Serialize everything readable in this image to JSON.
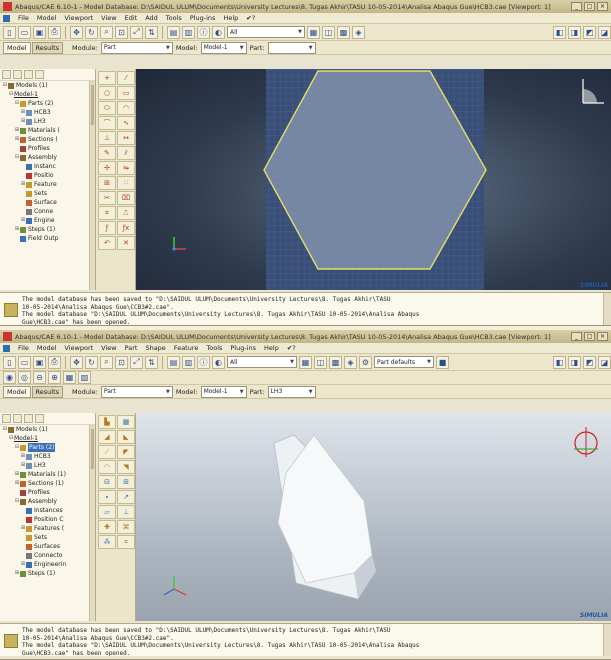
{
  "colors": {
    "viewport1_bg": "#2f3b4e",
    "part_fill": "#7f8fa6",
    "part_edge": "#e2dd6a",
    "mesh_grid": "#3d62b8",
    "selection": "#3d6fb7"
  },
  "panel1": {
    "window_title": "Abaqus/CAE 6.10-1 - Model Database: D:\\SAIDUL ULUM\\Documents\\University Lectures\\8. Tugas Akhir\\TASU 10-05-2014\\Analisa Abaqus Gue\\HCB3.cae [Viewport: 1]",
    "menus": [
      "File",
      "Model",
      "Viewport",
      "View",
      "Edit",
      "Add",
      "Tools",
      "Plug-ins",
      "Help",
      "✔?"
    ],
    "render_combo": "All",
    "tabs": [
      "Model",
      "Results"
    ],
    "module_label": "Module:",
    "module_value": "Part",
    "model_label": "Model:",
    "model_value": "Model-1",
    "part_label": "Part:",
    "part_value": "",
    "tree": [
      {
        "label": "Models (1)",
        "exp": "⊟",
        "indent": 0,
        "icon": "models-icon",
        "color": "#8a6b2f"
      },
      {
        "label": "Model-1",
        "exp": "⊟",
        "indent": 1,
        "icon": "",
        "color": ""
      },
      {
        "label": "Parts (2)",
        "exp": "⊟",
        "indent": 2,
        "icon": "parts-icon",
        "color": "#c49a2c"
      },
      {
        "label": "HCB3",
        "exp": "⊞",
        "indent": 3,
        "icon": "part-icon",
        "color": "#6f8fb8"
      },
      {
        "label": "LH3",
        "exp": "⊞",
        "indent": 3,
        "icon": "part-icon",
        "color": "#6f8fb8"
      },
      {
        "label": "Materials (",
        "exp": "⊞",
        "indent": 2,
        "icon": "materials-icon",
        "color": "#6b8f3a"
      },
      {
        "label": "Sections (",
        "exp": "⊞",
        "indent": 2,
        "icon": "sections-icon",
        "color": "#c4612c"
      },
      {
        "label": "Profiles",
        "exp": "",
        "indent": 2,
        "icon": "profiles-icon",
        "color": "#a04040"
      },
      {
        "label": "Assembly",
        "exp": "⊟",
        "indent": 2,
        "icon": "assembly-icon",
        "color": "#8a6b2f"
      },
      {
        "label": "Instanc",
        "exp": "",
        "indent": 3,
        "icon": "instances-icon",
        "color": "#3d6fb7"
      },
      {
        "label": "Positio",
        "exp": "",
        "indent": 3,
        "icon": "position-icon",
        "color": "#b33"
      },
      {
        "label": "Feature",
        "exp": "⊞",
        "indent": 3,
        "icon": "features-icon",
        "color": "#c49a2c"
      },
      {
        "label": "Sets",
        "exp": "",
        "indent": 3,
        "icon": "sets-icon",
        "color": "#c49a2c"
      },
      {
        "label": "Surface",
        "exp": "",
        "indent": 3,
        "icon": "surfaces-icon",
        "color": "#c4612c"
      },
      {
        "label": "Conne",
        "exp": "",
        "indent": 3,
        "icon": "connectors-icon",
        "color": "#777"
      },
      {
        "label": "Engine",
        "exp": "⊞",
        "indent": 3,
        "icon": "engineering-icon",
        "color": "#3d6fb7"
      },
      {
        "label": "Steps (1)",
        "exp": "⊞",
        "indent": 2,
        "icon": "steps-icon",
        "color": "#6b8f3a"
      },
      {
        "label": "Field Outp",
        "exp": "",
        "indent": 2,
        "icon": "field-output-icon",
        "color": "#3d6fb7"
      }
    ],
    "messages": "The model database has been saved to \"D:\\SAIDUL ULUM\\Documents\\University Lectures\\8. Tugas Akhir\\TASU\n10-05-2014\\Analisa Abaqus Gue\\CCB3#2.cae\".\nThe model database \"D:\\SAIDUL ULUM\\Documents\\University Lectures\\8. Tugas Akhir\\TASU 10-05-2014\\Analisa Abaqus\nGue\\HCB3.cae\" has been opened.",
    "logo": "SIMULIA"
  },
  "panel2": {
    "window_title": "Abaqus/CAE 6.10-1 - Model Database: D:\\SAIDUL ULUM\\Documents\\University Lectures\\8. Tugas Akhir\\TASU 10-05-2014\\Analisa Abaqus Gue\\HCB3.cae [Viewport: 1]",
    "menus": [
      "File",
      "Model",
      "Viewport",
      "View",
      "Part",
      "Shape",
      "Feature",
      "Tools",
      "Plug-ins",
      "Help",
      "✔?"
    ],
    "render_combo": "All",
    "part_defaults": "Part defaults",
    "tabs": [
      "Model",
      "Results"
    ],
    "module_label": "Module:",
    "module_value": "Part",
    "model_label": "Model:",
    "model_value": "Model-1",
    "part_label": "Part:",
    "part_value": "LH3",
    "tree": [
      {
        "label": "Models (1)",
        "exp": "⊟",
        "indent": 0,
        "icon": "models-icon",
        "color": "#8a6b2f"
      },
      {
        "label": "Model-1",
        "exp": "⊟",
        "indent": 1,
        "icon": "",
        "color": ""
      },
      {
        "label": "Parts (2)",
        "exp": "⊟",
        "indent": 2,
        "icon": "parts-icon",
        "color": "#c49a2c",
        "selected": true
      },
      {
        "label": "HCB3",
        "exp": "⊞",
        "indent": 3,
        "icon": "part-icon",
        "color": "#6f8fb8"
      },
      {
        "label": "LH3",
        "exp": "⊞",
        "indent": 3,
        "icon": "part-icon",
        "color": "#6f8fb8"
      },
      {
        "label": "Materials (1)",
        "exp": "⊞",
        "indent": 2,
        "icon": "materials-icon",
        "color": "#6b8f3a"
      },
      {
        "label": "Sections (1)",
        "exp": "⊞",
        "indent": 2,
        "icon": "sections-icon",
        "color": "#c4612c"
      },
      {
        "label": "Profiles",
        "exp": "",
        "indent": 2,
        "icon": "profiles-icon",
        "color": "#a04040"
      },
      {
        "label": "Assembly",
        "exp": "⊟",
        "indent": 2,
        "icon": "assembly-icon",
        "color": "#8a6b2f"
      },
      {
        "label": "Instances",
        "exp": "",
        "indent": 3,
        "icon": "instances-icon",
        "color": "#3d6fb7"
      },
      {
        "label": "Position C",
        "exp": "",
        "indent": 3,
        "icon": "position-icon",
        "color": "#b33"
      },
      {
        "label": "Features (",
        "exp": "⊞",
        "indent": 3,
        "icon": "features-icon",
        "color": "#c49a2c"
      },
      {
        "label": "Sets",
        "exp": "",
        "indent": 3,
        "icon": "sets-icon",
        "color": "#c49a2c"
      },
      {
        "label": "Surfaces",
        "exp": "",
        "indent": 3,
        "icon": "surfaces-icon",
        "color": "#c4612c"
      },
      {
        "label": "Connecto",
        "exp": "",
        "indent": 3,
        "icon": "connectors-icon",
        "color": "#777"
      },
      {
        "label": "Engineerin",
        "exp": "⊞",
        "indent": 3,
        "icon": "engineering-icon",
        "color": "#3d6fb7"
      },
      {
        "label": "Steps (1)",
        "exp": "⊞",
        "indent": 2,
        "icon": "steps-icon",
        "color": "#6b8f3a"
      }
    ],
    "messages": "The model database has been saved to \"D:\\SAIDUL ULUM\\Documents\\University Lectures\\8. Tugas Akhir\\TASU\n10-05-2014\\Analisa Abaqus Gue\\CCB3#2.cae\".\nThe model database \"D:\\SAIDUL ULUM\\Documents\\University Lectures\\8. Tugas Akhir\\TASU 10-05-2014\\Analisa Abaqus\nGue\\HCB3.cae\" has been opened.",
    "logo": "SIMULIA"
  }
}
